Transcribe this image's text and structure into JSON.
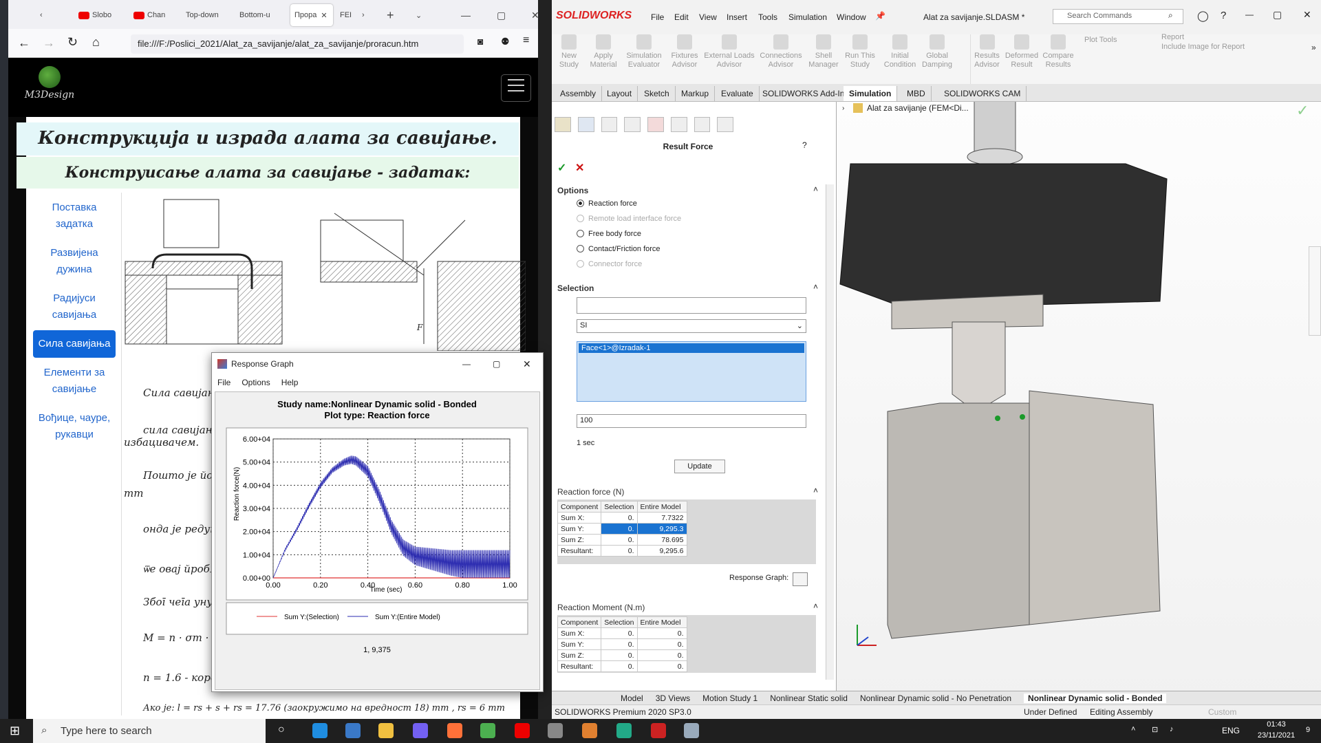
{
  "firefox": {
    "tabs": [
      "Slobo",
      "Chan",
      "Top-down",
      "Bottom-u",
      "Прора",
      "FEI"
    ],
    "url": "file:///F:/Poslici_2021/Alat_za_savijanje/alat_za_savijanje/proracun.htm",
    "site": {
      "logo_text": "M3Design",
      "heading1": "Конструкција и израда алата за савијање.",
      "heading2": "Конструисање алата за савијање - задатак:",
      "nav": [
        "Поставка задатка",
        "Развијена дужина",
        "Радијуси савијања",
        "Сила савијања",
        "Елементи за савијање",
        "Вођице, чауре, рукавци"
      ],
      "paragraphs": [
        "Сила савијањ",
        "сила савијањ",
        "избацивачем.",
        "Пошто је йол",
        "mm",
        "онда је редук",
        "ѿе овај йробл",
        "Збоī чеīа унуѿ",
        "M = n · σm · b · s / 4",
        "n = 1.6 - коре",
        "Ако је: l = rs + s + rs = 17.76 (заокружимо на вредност 18) mm , rs = 6 mm"
      ]
    }
  },
  "response_graph": {
    "window_title": "Response Graph",
    "menu": [
      "File",
      "Options",
      "Help"
    ],
    "title_line1": "Study name:Nonlinear Dynamic solid - Bonded",
    "title_line2": "Plot type: Reaction force",
    "footer": "1, 9,375"
  },
  "chart_data": {
    "type": "line",
    "title": "Study name:Nonlinear Dynamic solid - Bonded / Plot type: Reaction force",
    "xlabel": "Time (sec)",
    "ylabel": "Reaction force(N)",
    "xlim": [
      0,
      1
    ],
    "ylim": [
      0,
      60000
    ],
    "xticks": [
      "0.00",
      "0.20",
      "0.40",
      "0.60",
      "0.80",
      "1.00"
    ],
    "yticks": [
      "0.00+00",
      "1.00+04",
      "2.00+04",
      "3.00+04",
      "4.00+04",
      "5.00+04",
      "6.00+04"
    ],
    "grid": true,
    "legend_position": "bottom",
    "series": [
      {
        "name": "Sum Y:(Selection)",
        "color": "#e03030",
        "x": [
          0,
          1
        ],
        "y": [
          0,
          0
        ]
      },
      {
        "name": "Sum Y:(Entire Model)",
        "color": "#2a2ab0",
        "x": [
          0.0,
          0.05,
          0.1,
          0.15,
          0.2,
          0.25,
          0.3,
          0.33,
          0.35,
          0.4,
          0.45,
          0.5,
          0.55,
          0.6,
          0.65,
          0.7,
          0.75,
          0.8,
          0.85,
          0.9,
          0.95,
          1.0
        ],
        "y": [
          0,
          12000,
          21000,
          31000,
          40000,
          46500,
          50000,
          51000,
          50500,
          46000,
          35000,
          22000,
          13000,
          9500,
          8500,
          7500,
          6500,
          6000,
          5500,
          5000,
          4500,
          4000
        ],
        "oscillation_amplitude": [
          0,
          500,
          800,
          1000,
          1200,
          1200,
          1500,
          1800,
          2000,
          2400,
          2800,
          3000,
          3500,
          4000,
          4500,
          5000,
          5500,
          6000,
          6500,
          7000,
          7500,
          8000
        ]
      }
    ]
  },
  "solidworks": {
    "brand": "SOLIDWORKS",
    "menu": [
      "File",
      "Edit",
      "View",
      "Insert",
      "Tools",
      "Simulation",
      "Window"
    ],
    "doc_title": "Alat za savijanje.SLDASM *",
    "search_placeholder": "Search Commands",
    "command_buttons": [
      "New Study",
      "Apply Material",
      "Simulation Evaluator",
      "Fixtures Advisor",
      "External Loads Advisor",
      "Connections Advisor",
      "Shell Manager",
      "Run This Study",
      "Initial Condition",
      "Global Damping",
      "Results Advisor",
      "Deformed Result",
      "Compare Results"
    ],
    "plot_tools": "Plot Tools",
    "report": "Report",
    "include_image": "Include Image for Report",
    "tabs": [
      "Assembly",
      "Layout",
      "Sketch",
      "Markup",
      "Evaluate",
      "SOLIDWORKS Add-Ins",
      "Simulation",
      "MBD",
      "SOLIDWORKS CAM"
    ],
    "active_tab": "Simulation",
    "pm_title": "Result Force",
    "options_label": "Options",
    "options": [
      "Reaction force",
      "Remote load interface force",
      "Free body force",
      "Contact/Friction force",
      "Connector force"
    ],
    "selection_label": "Selection",
    "units": "SI",
    "selected_face": "Face<1>@Izradak-1",
    "step_value": "100",
    "time_label": "1 sec",
    "update_button": "Update",
    "reaction_force_label": "Reaction force (N)",
    "reaction_force_headers": [
      "Component",
      "Selection",
      "Entire Model"
    ],
    "reaction_force_rows": [
      [
        "Sum X:",
        "0.",
        "7.7322"
      ],
      [
        "Sum Y:",
        "0.",
        "9,295.3"
      ],
      [
        "Sum Z:",
        "0.",
        "78.695"
      ],
      [
        "Resultant:",
        "0.",
        "9,295.6"
      ]
    ],
    "response_graph_label": "Response Graph:",
    "reaction_moment_label": "Reaction Moment (N.m)",
    "reaction_moment_rows": [
      [
        "Sum X:",
        "0.",
        "0."
      ],
      [
        "Sum Y:",
        "0.",
        "0."
      ],
      [
        "Sum Z:",
        "0.",
        "0."
      ],
      [
        "Resultant:",
        "0.",
        "0."
      ]
    ],
    "tree_item": "Alat za savijanje  (FEM<Di...",
    "bottom_tabs": [
      "Model",
      "3D Views",
      "Motion Study 1",
      "Nonlinear Static solid",
      "Nonlinear Dynamic solid - No Penetration",
      "Nonlinear Dynamic solid - Bonded"
    ],
    "status_left": "SOLIDWORKS Premium 2020 SP3.0",
    "status_mid1": "Under Defined",
    "status_mid2": "Editing Assembly",
    "status_right": "Custom"
  },
  "taskbar": {
    "search_placeholder": "Type here to search",
    "lang": "ENG",
    "time": "01:43",
    "date": "23/11/2021",
    "notifications": "9"
  }
}
